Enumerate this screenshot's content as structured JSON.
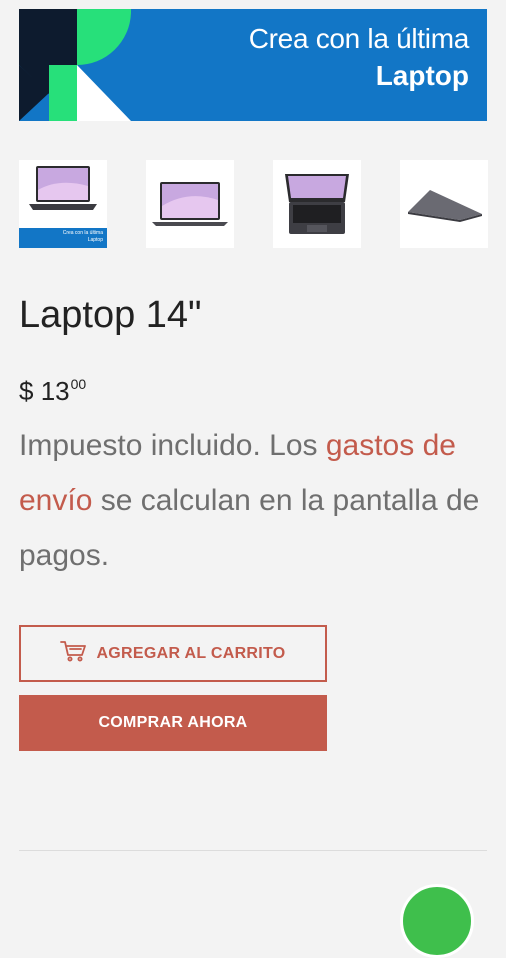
{
  "banner": {
    "line1": "Crea con la última",
    "line2": "Laptop",
    "colors": {
      "background": "#1276c6",
      "accent": "#27e07a",
      "dark": "#0d1b2e"
    }
  },
  "thumbnails": [
    {
      "name": "laptop-front-banner",
      "strip_line1": "Crea con la última",
      "strip_line2": "Laptop"
    },
    {
      "name": "laptop-front"
    },
    {
      "name": "laptop-top"
    },
    {
      "name": "laptop-side"
    }
  ],
  "product": {
    "title": "Laptop 14\"",
    "price_currency": "$",
    "price_whole": "13",
    "price_cents": "00"
  },
  "tax": {
    "text_before": "Impuesto incluido. Los ",
    "link_text": "gastos de envío",
    "text_after": " se calculan en la pantalla de pagos."
  },
  "buttons": {
    "add_to_cart": "AGREGAR AL CARRITO",
    "buy_now": "COMPRAR AHORA",
    "cart_icon": "cart-icon"
  },
  "colors": {
    "accent": "#c35b4c",
    "text": "#222222",
    "muted": "#6f6f6f",
    "page_bg": "#f3f3f3",
    "chat_fab": "#3fbf4c"
  }
}
